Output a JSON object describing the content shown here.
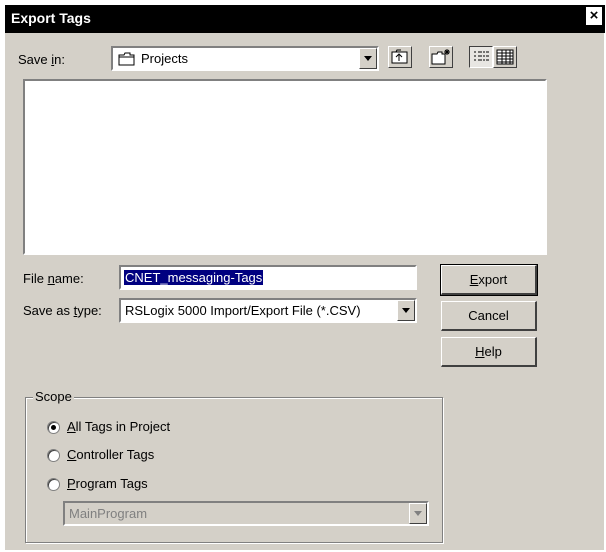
{
  "window": {
    "title": "Export Tags",
    "close_glyph": "×"
  },
  "save_in": {
    "label_pre": "Save ",
    "label_accel": "i",
    "label_post": "n:",
    "value": "Projects"
  },
  "file_name": {
    "label_pre": "File ",
    "label_accel": "n",
    "label_post": "ame:",
    "value": "CNET_messaging-Tags"
  },
  "save_as_type": {
    "label_pre": "Save as ",
    "label_accel": "t",
    "label_post": "ype:",
    "value": "RSLogix 5000 Import/Export File (*.CSV)"
  },
  "buttons": {
    "export": {
      "accel": "E",
      "rest": "xport"
    },
    "cancel": "Cancel",
    "help": {
      "accel": "H",
      "rest": "elp"
    }
  },
  "scope": {
    "legend": "Scope",
    "options": [
      {
        "accel": "A",
        "rest": "ll Tags in Project",
        "checked": true
      },
      {
        "accel": "C",
        "rest": "ontroller Tags",
        "checked": false
      },
      {
        "accel": "P",
        "rest": "rogram Tags",
        "checked": false
      }
    ],
    "program_select": "MainProgram"
  },
  "toolbar": {
    "icons": [
      "up-folder-icon",
      "new-folder-icon",
      "list-view-icon",
      "details-view-icon"
    ]
  }
}
